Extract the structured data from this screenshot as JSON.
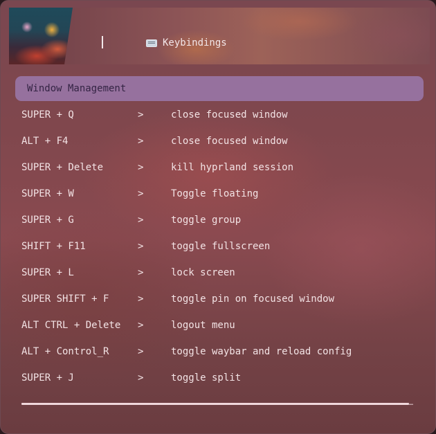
{
  "header": {
    "title": "Keybindings",
    "title_icon": "keyboard-icon"
  },
  "category": {
    "label": "Window Management"
  },
  "separator": ">",
  "bindings": [
    {
      "keys": "SUPER + Q",
      "action": "close focused window"
    },
    {
      "keys": "ALT + F4",
      "action": "close focused window"
    },
    {
      "keys": "SUPER + Delete",
      "action": "kill hyprland session"
    },
    {
      "keys": "SUPER + W",
      "action": "Toggle floating"
    },
    {
      "keys": "SUPER + G",
      "action": "toggle group"
    },
    {
      "keys": "SHIFT + F11",
      "action": "toggle fullscreen"
    },
    {
      "keys": "SUPER + L",
      "action": "lock screen"
    },
    {
      "keys": "SUPER SHIFT + F",
      "action": "toggle pin on focused window"
    },
    {
      "keys": "ALT CTRL + Delete",
      "action": "logout menu"
    },
    {
      "keys": "ALT + Control_R",
      "action": "toggle waybar and reload config"
    },
    {
      "keys": "SUPER + J",
      "action": "toggle split"
    }
  ],
  "overflow_indicator": "…",
  "colors": {
    "category_highlight": "#a082be",
    "text": "#f3e3e5",
    "background": "#80474d"
  }
}
